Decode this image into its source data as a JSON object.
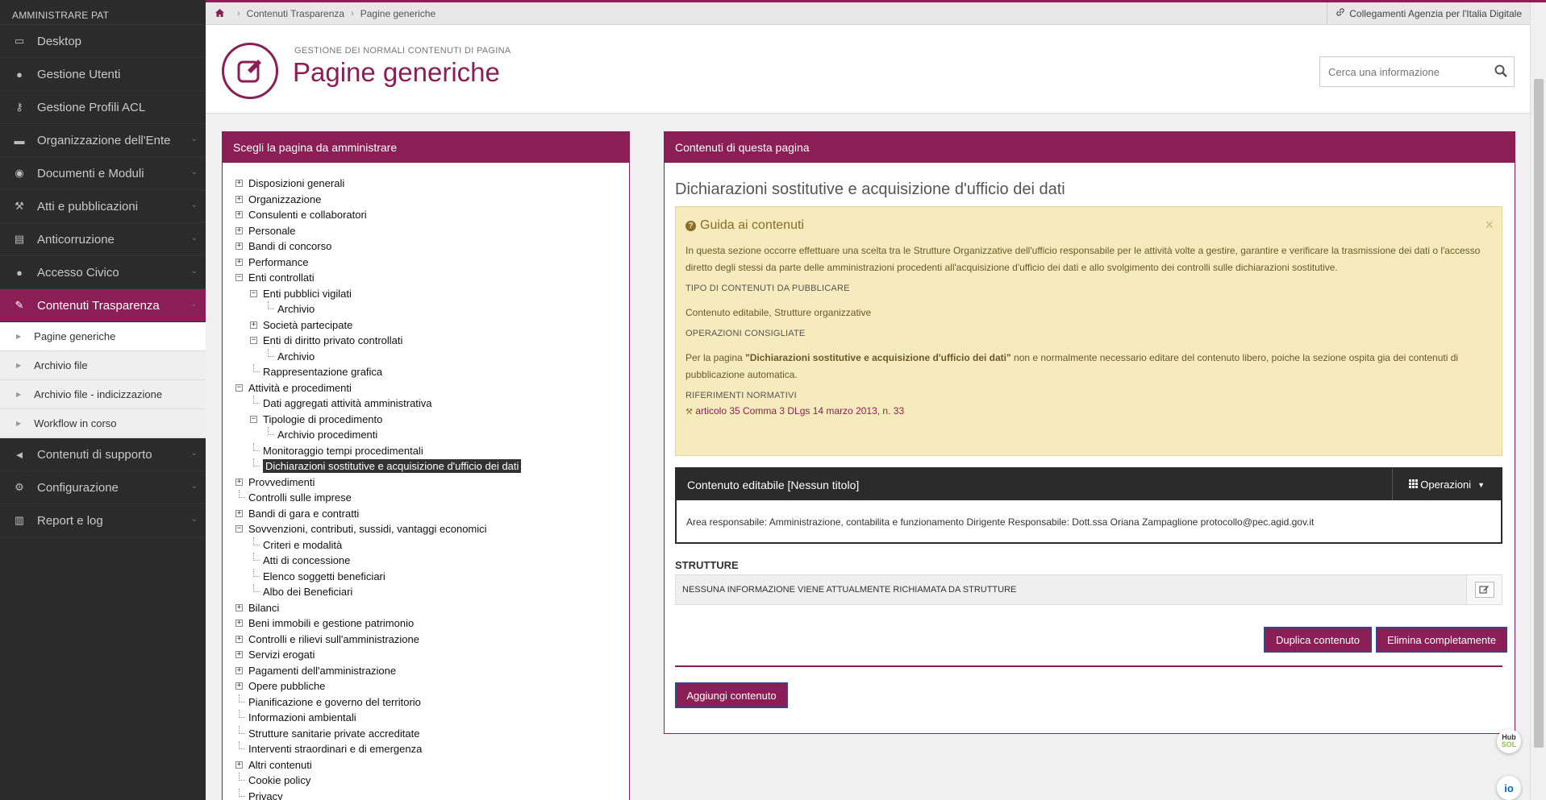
{
  "sidebar": {
    "header": "AMMINISTRARE PAT",
    "items": [
      {
        "label": "Desktop",
        "icon": "laptop-icon"
      },
      {
        "label": "Gestione Utenti",
        "icon": "user-icon"
      },
      {
        "label": "Gestione Profili ACL",
        "icon": "key-icon"
      },
      {
        "label": "Organizzazione dell'Ente",
        "icon": "briefcase-icon"
      },
      {
        "label": "Documenti e Moduli",
        "icon": "circle-arrow-icon"
      },
      {
        "label": "Atti e pubblicazioni",
        "icon": "gavel-icon"
      },
      {
        "label": "Anticorruzione",
        "icon": "book-icon"
      },
      {
        "label": "Accesso Civico",
        "icon": "comments-icon"
      },
      {
        "label": "Contenuti Trasparenza",
        "icon": "edit-icon"
      }
    ],
    "subitems": [
      "Pagine generiche",
      "Archivio file",
      "Archivio file - indicizzazione",
      "Workflow in corso"
    ],
    "items2": [
      {
        "label": "Contenuti di supporto",
        "icon": "bullhorn-icon"
      },
      {
        "label": "Configurazione",
        "icon": "cogs-icon"
      },
      {
        "label": "Report e log",
        "icon": "bar-chart-icon"
      }
    ]
  },
  "breadcrumb": {
    "items": [
      "Contenuti Trasparenza",
      "Pagine generiche"
    ],
    "agid_link": "Collegamenti Agenzia per l'Italia Digitale"
  },
  "header": {
    "subtitle": "GESTIONE DEI NORMALI CONTENUTI DI PAGINA",
    "title": "Pagine generiche",
    "search_placeholder": "Cerca una informazione"
  },
  "left_panel": {
    "title": "Scegli la pagina da amministrare",
    "tree": [
      {
        "label": "Disposizioni generali",
        "level": 0,
        "toggle": "plus"
      },
      {
        "label": "Organizzazione",
        "level": 0,
        "toggle": "plus"
      },
      {
        "label": "Consulenti e collaboratori",
        "level": 0,
        "toggle": "plus"
      },
      {
        "label": "Personale",
        "level": 0,
        "toggle": "plus"
      },
      {
        "label": "Bandi di concorso",
        "level": 0,
        "toggle": "plus"
      },
      {
        "label": "Performance",
        "level": 0,
        "toggle": "plus"
      },
      {
        "label": "Enti controllati",
        "level": 0,
        "toggle": "minus"
      },
      {
        "label": "Enti pubblici vigilati",
        "level": 1,
        "toggle": "minus"
      },
      {
        "label": "Archivio",
        "level": 2,
        "toggle": "none"
      },
      {
        "label": "Società partecipate",
        "level": 1,
        "toggle": "plus"
      },
      {
        "label": "Enti di diritto privato controllati",
        "level": 1,
        "toggle": "minus"
      },
      {
        "label": "Archivio",
        "level": 2,
        "toggle": "none"
      },
      {
        "label": "Rappresentazione grafica",
        "level": 1,
        "toggle": "none"
      },
      {
        "label": "Attività e procedimenti",
        "level": 0,
        "toggle": "minus"
      },
      {
        "label": "Dati aggregati attività amministrativa",
        "level": 1,
        "toggle": "none"
      },
      {
        "label": "Tipologie di procedimento",
        "level": 1,
        "toggle": "minus"
      },
      {
        "label": "Archivio procedimenti",
        "level": 2,
        "toggle": "none"
      },
      {
        "label": "Monitoraggio tempi procedimentali",
        "level": 1,
        "toggle": "none"
      },
      {
        "label": "Dichiarazioni sostitutive e acquisizione d'ufficio dei dati",
        "level": 1,
        "toggle": "none",
        "selected": true
      },
      {
        "label": "Provvedimenti",
        "level": 0,
        "toggle": "plus"
      },
      {
        "label": "Controlli sulle imprese",
        "level": 0,
        "toggle": "none"
      },
      {
        "label": "Bandi di gara e contratti",
        "level": 0,
        "toggle": "plus"
      },
      {
        "label": "Sovvenzioni, contributi, sussidi, vantaggi economici",
        "level": 0,
        "toggle": "minus"
      },
      {
        "label": "Criteri e modalità",
        "level": 1,
        "toggle": "none"
      },
      {
        "label": "Atti di concessione",
        "level": 1,
        "toggle": "none"
      },
      {
        "label": "Elenco soggetti beneficiari",
        "level": 1,
        "toggle": "none"
      },
      {
        "label": "Albo dei Beneficiari",
        "level": 1,
        "toggle": "none"
      },
      {
        "label": "Bilanci",
        "level": 0,
        "toggle": "plus"
      },
      {
        "label": "Beni immobili e gestione patrimonio",
        "level": 0,
        "toggle": "plus"
      },
      {
        "label": "Controlli e rilievi sull'amministrazione",
        "level": 0,
        "toggle": "plus"
      },
      {
        "label": "Servizi erogati",
        "level": 0,
        "toggle": "plus"
      },
      {
        "label": "Pagamenti dell'amministrazione",
        "level": 0,
        "toggle": "plus"
      },
      {
        "label": "Opere pubbliche",
        "level": 0,
        "toggle": "plus"
      },
      {
        "label": "Pianificazione e governo del territorio",
        "level": 0,
        "toggle": "none"
      },
      {
        "label": "Informazioni ambientali",
        "level": 0,
        "toggle": "none"
      },
      {
        "label": "Strutture sanitarie private accreditate",
        "level": 0,
        "toggle": "none"
      },
      {
        "label": "Interventi straordinari e di emergenza",
        "level": 0,
        "toggle": "none"
      },
      {
        "label": "Altri contenuti",
        "level": 0,
        "toggle": "plus"
      },
      {
        "label": "Cookie policy",
        "level": 0,
        "toggle": "none"
      },
      {
        "label": "Privacy",
        "level": 0,
        "toggle": "none"
      }
    ]
  },
  "right_panel": {
    "title": "Contenuti di questa pagina",
    "content_title": "Dichiarazioni sostitutive e acquisizione d'ufficio dei dati",
    "guide": {
      "title": "Guida ai contenuti",
      "text": "In questa sezione occorre effettuare una scelta tra le Strutture Organizzative dell'ufficio responsabile per le attività volte a gestire, garantire e verificare la trasmissione dei dati o l'accesso diretto degli stessi da parte delle amministrazioni procedenti all'acquisizione d'ufficio dei dati e allo svolgimento dei controlli sulle dichiarazioni sostitutive.",
      "h_tipo": "TIPO DI CONTENUTI DA PUBBLICARE",
      "tipo": "Contenuto editabile, Strutture organizzative",
      "h_ops": "OPERAZIONI CONSIGLIATE",
      "ops_pre": "Per la pagina ",
      "ops_bold": "\"Dichiarazioni sostitutive e acquisizione d'ufficio dei dati\"",
      "ops_post": " non e normalmente necessario editare del contenuto libero, poiche la sezione ospita gia dei contenuti di pubblicazione automatica.",
      "h_rif": "RIFERIMENTI NORMATIVI",
      "ref": "articolo 35 Comma 3 DLgs 14 marzo 2013, n. 33"
    },
    "editor": {
      "title": "Contenuto editabile [Nessun titolo]",
      "ops": "Operazioni",
      "body": "Area responsabile: Amministrazione, contabilita e funzionamento Dirigente Responsabile: Dott.ssa Oriana Zampaglione protocollo@pec.agid.gov.it"
    },
    "strutture_heading": "STRUTTURE",
    "strutture_empty": "NESSUNA INFORMAZIONE VIENE ATTUALMENTE RICHIAMATA DA STRUTTURE",
    "btn_duplica": "Duplica contenuto",
    "btn_elimina": "Elimina completamente",
    "btn_aggiungi": "Aggiungi contenuto"
  },
  "fab": {
    "hub_top": "Hub",
    "hub_bottom": "SOL",
    "io": "io"
  },
  "colors": {
    "brand": "#8b1e54",
    "sidebar": "#2b2b2b",
    "guide_bg": "#f6ebbc"
  }
}
